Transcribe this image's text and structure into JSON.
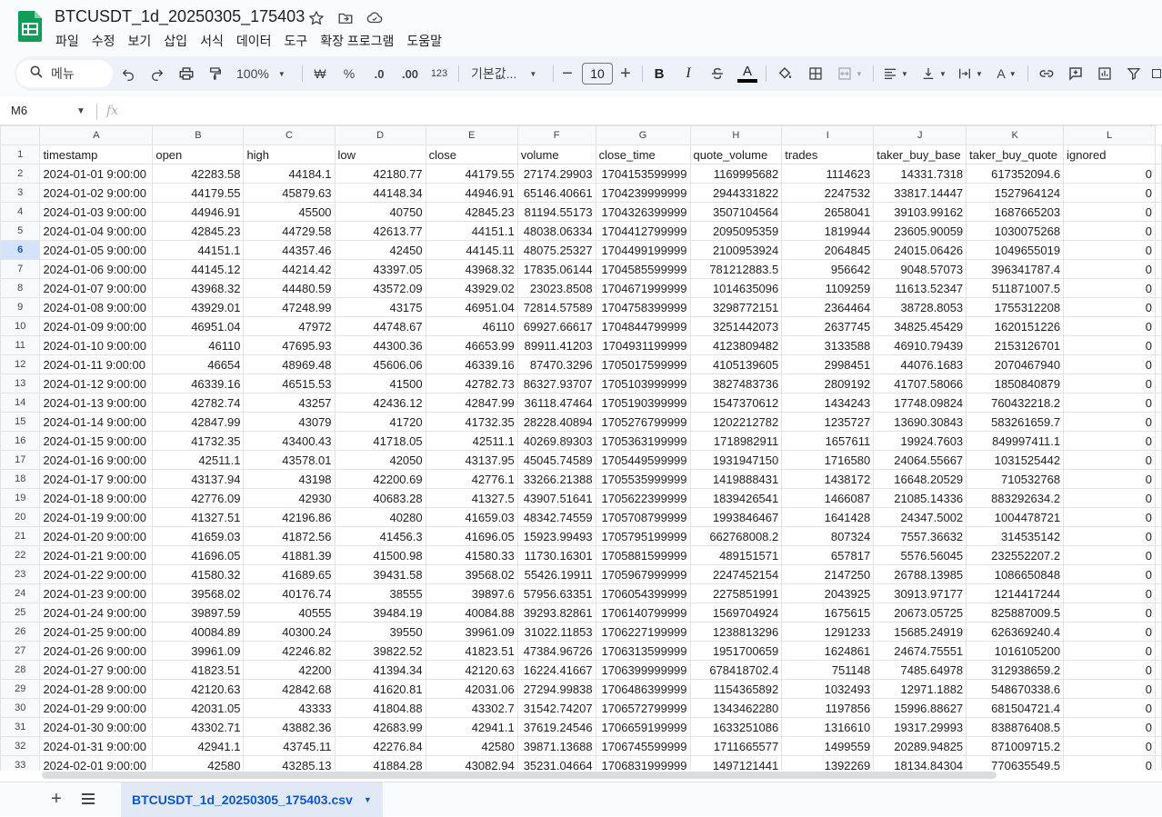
{
  "header": {
    "doc_title": "BTCUSDT_1d_20250305_175403",
    "menu": [
      "파일",
      "수정",
      "보기",
      "삽입",
      "서식",
      "데이터",
      "도구",
      "확장 프로그램",
      "도움말"
    ]
  },
  "toolbar": {
    "search_label": "메뉴",
    "zoom": "100%",
    "currency": "₩",
    "percent": "%",
    "dec_decrease": ".0",
    "dec_increase": ".00",
    "number_format": "123",
    "font_name": "기본값...",
    "font_size": "10"
  },
  "formula_bar": {
    "cell_ref": "M6",
    "fx": "fx"
  },
  "grid": {
    "columns": [
      "A",
      "B",
      "C",
      "D",
      "E",
      "F",
      "G",
      "H",
      "I",
      "J",
      "K",
      "L"
    ],
    "row_numbers": [
      "1",
      "2",
      "3",
      "4",
      "5",
      "6",
      "7",
      "8",
      "9",
      "10",
      "11",
      "12",
      "13",
      "14",
      "15",
      "16",
      "17",
      "18",
      "19",
      "20",
      "21",
      "22",
      "23",
      "24",
      "25",
      "26",
      "27",
      "28",
      "29",
      "30",
      "31",
      "32",
      "33"
    ],
    "header_row": [
      "timestamp",
      "open",
      "high",
      "low",
      "close",
      "volume",
      "close_time",
      "quote_volume",
      "trades",
      "taker_buy_base",
      "taker_buy_quote",
      "ignored"
    ],
    "rows": [
      [
        "2024-01-01 9:00:00",
        "42283.58",
        "44184.1",
        "42180.77",
        "44179.55",
        "27174.29903",
        "1704153599999",
        "1169995682",
        "1114623",
        "14331.7318",
        "617352094.6",
        "0"
      ],
      [
        "2024-01-02 9:00:00",
        "44179.55",
        "45879.63",
        "44148.34",
        "44946.91",
        "65146.40661",
        "1704239999999",
        "2944331822",
        "2247532",
        "33817.14447",
        "1527964124",
        "0"
      ],
      [
        "2024-01-03 9:00:00",
        "44946.91",
        "45500",
        "40750",
        "42845.23",
        "81194.55173",
        "1704326399999",
        "3507104564",
        "2658041",
        "39103.99162",
        "1687665203",
        "0"
      ],
      [
        "2024-01-04 9:00:00",
        "42845.23",
        "44729.58",
        "42613.77",
        "44151.1",
        "48038.06334",
        "1704412799999",
        "2095095359",
        "1819944",
        "23605.90059",
        "1030075268",
        "0"
      ],
      [
        "2024-01-05 9:00:00",
        "44151.1",
        "44357.46",
        "42450",
        "44145.11",
        "48075.25327",
        "1704499199999",
        "2100953924",
        "2064845",
        "24015.06426",
        "1049655019",
        "0"
      ],
      [
        "2024-01-06 9:00:00",
        "44145.12",
        "44214.42",
        "43397.05",
        "43968.32",
        "17835.06144",
        "1704585599999",
        "781212883.5",
        "956642",
        "9048.57073",
        "396341787.4",
        "0"
      ],
      [
        "2024-01-07 9:00:00",
        "43968.32",
        "44480.59",
        "43572.09",
        "43929.02",
        "23023.8508",
        "1704671999999",
        "1014635096",
        "1109259",
        "11613.52347",
        "511871007.5",
        "0"
      ],
      [
        "2024-01-08 9:00:00",
        "43929.01",
        "47248.99",
        "43175",
        "46951.04",
        "72814.57589",
        "1704758399999",
        "3298772151",
        "2364464",
        "38728.8053",
        "1755312208",
        "0"
      ],
      [
        "2024-01-09 9:00:00",
        "46951.04",
        "47972",
        "44748.67",
        "46110",
        "69927.66617",
        "1704844799999",
        "3251442073",
        "2637745",
        "34825.45429",
        "1620151226",
        "0"
      ],
      [
        "2024-01-10 9:00:00",
        "46110",
        "47695.93",
        "44300.36",
        "46653.99",
        "89911.41203",
        "1704931199999",
        "4123809482",
        "3133588",
        "46910.79439",
        "2153126701",
        "0"
      ],
      [
        "2024-01-11 9:00:00",
        "46654",
        "48969.48",
        "45606.06",
        "46339.16",
        "87470.3296",
        "1705017599999",
        "4105139605",
        "2998451",
        "44076.1683",
        "2070467940",
        "0"
      ],
      [
        "2024-01-12 9:00:00",
        "46339.16",
        "46515.53",
        "41500",
        "42782.73",
        "86327.93707",
        "1705103999999",
        "3827483736",
        "2809192",
        "41707.58066",
        "1850840879",
        "0"
      ],
      [
        "2024-01-13 9:00:00",
        "42782.74",
        "43257",
        "42436.12",
        "42847.99",
        "36118.47464",
        "1705190399999",
        "1547370612",
        "1434243",
        "17748.09824",
        "760432218.2",
        "0"
      ],
      [
        "2024-01-14 9:00:00",
        "42847.99",
        "43079",
        "41720",
        "41732.35",
        "28228.40894",
        "1705276799999",
        "1202212782",
        "1235727",
        "13690.30843",
        "583261659.7",
        "0"
      ],
      [
        "2024-01-15 9:00:00",
        "41732.35",
        "43400.43",
        "41718.05",
        "42511.1",
        "40269.89303",
        "1705363199999",
        "1718982911",
        "1657611",
        "19924.7603",
        "849997411.1",
        "0"
      ],
      [
        "2024-01-16 9:00:00",
        "42511.1",
        "43578.01",
        "42050",
        "43137.95",
        "45045.74589",
        "1705449599999",
        "1931947150",
        "1716580",
        "24064.55667",
        "1031525442",
        "0"
      ],
      [
        "2024-01-17 9:00:00",
        "43137.94",
        "43198",
        "42200.69",
        "42776.1",
        "33266.21388",
        "1705535999999",
        "1419888431",
        "1438172",
        "16648.20529",
        "710532768",
        "0"
      ],
      [
        "2024-01-18 9:00:00",
        "42776.09",
        "42930",
        "40683.28",
        "41327.5",
        "43907.51641",
        "1705622399999",
        "1839426541",
        "1466087",
        "21085.14336",
        "883292634.2",
        "0"
      ],
      [
        "2024-01-19 9:00:00",
        "41327.51",
        "42196.86",
        "40280",
        "41659.03",
        "48342.74559",
        "1705708799999",
        "1993846467",
        "1641428",
        "24347.5002",
        "1004478721",
        "0"
      ],
      [
        "2024-01-20 9:00:00",
        "41659.03",
        "41872.56",
        "41456.3",
        "41696.05",
        "15923.99493",
        "1705795199999",
        "662768008.2",
        "807324",
        "7557.36632",
        "314535142",
        "0"
      ],
      [
        "2024-01-21 9:00:00",
        "41696.05",
        "41881.39",
        "41500.98",
        "41580.33",
        "11730.16301",
        "1705881599999",
        "489151571",
        "657817",
        "5576.56045",
        "232552207.2",
        "0"
      ],
      [
        "2024-01-22 9:00:00",
        "41580.32",
        "41689.65",
        "39431.58",
        "39568.02",
        "55426.19911",
        "1705967999999",
        "2247452154",
        "2147250",
        "26788.13985",
        "1086650848",
        "0"
      ],
      [
        "2024-01-23 9:00:00",
        "39568.02",
        "40176.74",
        "38555",
        "39897.6",
        "57956.63351",
        "1706054399999",
        "2275851991",
        "2043925",
        "30913.97177",
        "1214417244",
        "0"
      ],
      [
        "2024-01-24 9:00:00",
        "39897.59",
        "40555",
        "39484.19",
        "40084.88",
        "39293.82861",
        "1706140799999",
        "1569704924",
        "1675615",
        "20673.05725",
        "825887009.5",
        "0"
      ],
      [
        "2024-01-25 9:00:00",
        "40084.89",
        "40300.24",
        "39550",
        "39961.09",
        "31022.11853",
        "1706227199999",
        "1238813296",
        "1291233",
        "15685.24919",
        "626369240.4",
        "0"
      ],
      [
        "2024-01-26 9:00:00",
        "39961.09",
        "42246.82",
        "39822.52",
        "41823.51",
        "47384.96726",
        "1706313599999",
        "1951700659",
        "1624861",
        "24674.75551",
        "1016105200",
        "0"
      ],
      [
        "2024-01-27 9:00:00",
        "41823.51",
        "42200",
        "41394.34",
        "42120.63",
        "16224.41667",
        "1706399999999",
        "678418702.4",
        "751148",
        "7485.64978",
        "312938659.2",
        "0"
      ],
      [
        "2024-01-28 9:00:00",
        "42120.63",
        "42842.68",
        "41620.81",
        "42031.06",
        "27294.99838",
        "1706486399999",
        "1154365892",
        "1032493",
        "12971.1882",
        "548670338.6",
        "0"
      ],
      [
        "2024-01-29 9:00:00",
        "42031.05",
        "43333",
        "41804.88",
        "43302.7",
        "31542.74207",
        "1706572799999",
        "1343462280",
        "1197856",
        "15996.88627",
        "681504721.4",
        "0"
      ],
      [
        "2024-01-30 9:00:00",
        "43302.71",
        "43882.36",
        "42683.99",
        "42941.1",
        "37619.24546",
        "1706659199999",
        "1633251086",
        "1316610",
        "19317.29993",
        "838876408.5",
        "0"
      ],
      [
        "2024-01-31 9:00:00",
        "42941.1",
        "43745.11",
        "42276.84",
        "42580",
        "39871.13688",
        "1706745599999",
        "1711665577",
        "1499559",
        "20289.94825",
        "871009715.2",
        "0"
      ],
      [
        "2024-02-01 9:00:00",
        "42580",
        "43285.13",
        "41884.28",
        "43082.94",
        "35231.04664",
        "1706831999999",
        "1497121441",
        "1392269",
        "18134.84304",
        "770635549.5",
        "0"
      ]
    ]
  },
  "sheet_tabs": {
    "active": "BTCUSDT_1d_20250305_175403.csv",
    "add_symbol": "+"
  },
  "colors": {
    "accent": "#0b57d0",
    "sheets_green": "#0f9d58"
  }
}
